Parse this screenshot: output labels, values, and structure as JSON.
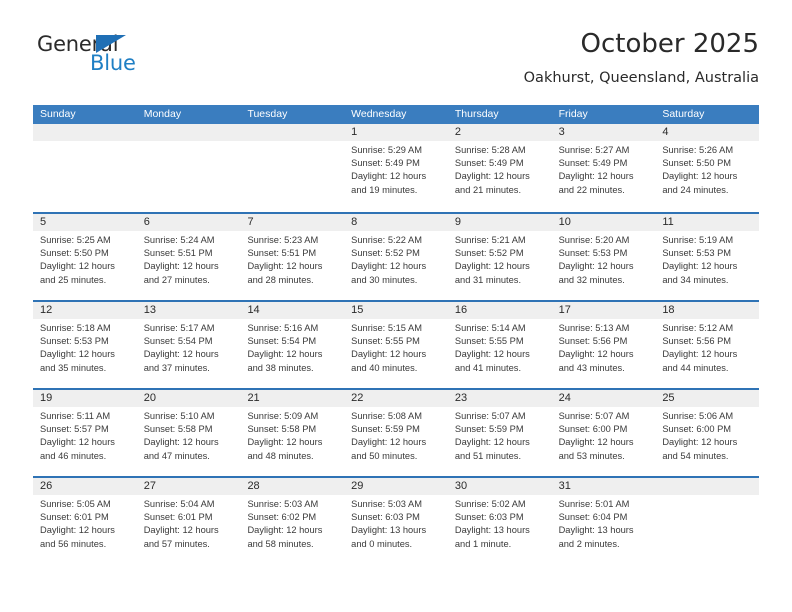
{
  "brand": {
    "name_top": "General",
    "name_bottom": "Blue",
    "triangle_icon": "triangle-icon",
    "colors": {
      "general_text": "#2b2b2b",
      "blue_text": "#1f7fc4",
      "triangle": "#1f6fb5"
    }
  },
  "header": {
    "title": "October 2025",
    "subtitle": "Oakhurst, Queensland, Australia"
  },
  "theme": {
    "header_blue": "#3a7dbf",
    "row_divider_blue": "#2f73b5",
    "day_band_gray": "#efefef"
  },
  "calendar": {
    "weekdays": [
      "Sunday",
      "Monday",
      "Tuesday",
      "Wednesday",
      "Thursday",
      "Friday",
      "Saturday"
    ],
    "weeks": [
      [
        {
          "day": "",
          "lines": []
        },
        {
          "day": "",
          "lines": []
        },
        {
          "day": "",
          "lines": []
        },
        {
          "day": "1",
          "lines": [
            "Sunrise: 5:29 AM",
            "Sunset: 5:49 PM",
            "Daylight: 12 hours",
            "and 19 minutes."
          ]
        },
        {
          "day": "2",
          "lines": [
            "Sunrise: 5:28 AM",
            "Sunset: 5:49 PM",
            "Daylight: 12 hours",
            "and 21 minutes."
          ]
        },
        {
          "day": "3",
          "lines": [
            "Sunrise: 5:27 AM",
            "Sunset: 5:49 PM",
            "Daylight: 12 hours",
            "and 22 minutes."
          ]
        },
        {
          "day": "4",
          "lines": [
            "Sunrise: 5:26 AM",
            "Sunset: 5:50 PM",
            "Daylight: 12 hours",
            "and 24 minutes."
          ]
        }
      ],
      [
        {
          "day": "5",
          "lines": [
            "Sunrise: 5:25 AM",
            "Sunset: 5:50 PM",
            "Daylight: 12 hours",
            "and 25 minutes."
          ]
        },
        {
          "day": "6",
          "lines": [
            "Sunrise: 5:24 AM",
            "Sunset: 5:51 PM",
            "Daylight: 12 hours",
            "and 27 minutes."
          ]
        },
        {
          "day": "7",
          "lines": [
            "Sunrise: 5:23 AM",
            "Sunset: 5:51 PM",
            "Daylight: 12 hours",
            "and 28 minutes."
          ]
        },
        {
          "day": "8",
          "lines": [
            "Sunrise: 5:22 AM",
            "Sunset: 5:52 PM",
            "Daylight: 12 hours",
            "and 30 minutes."
          ]
        },
        {
          "day": "9",
          "lines": [
            "Sunrise: 5:21 AM",
            "Sunset: 5:52 PM",
            "Daylight: 12 hours",
            "and 31 minutes."
          ]
        },
        {
          "day": "10",
          "lines": [
            "Sunrise: 5:20 AM",
            "Sunset: 5:53 PM",
            "Daylight: 12 hours",
            "and 32 minutes."
          ]
        },
        {
          "day": "11",
          "lines": [
            "Sunrise: 5:19 AM",
            "Sunset: 5:53 PM",
            "Daylight: 12 hours",
            "and 34 minutes."
          ]
        }
      ],
      [
        {
          "day": "12",
          "lines": [
            "Sunrise: 5:18 AM",
            "Sunset: 5:53 PM",
            "Daylight: 12 hours",
            "and 35 minutes."
          ]
        },
        {
          "day": "13",
          "lines": [
            "Sunrise: 5:17 AM",
            "Sunset: 5:54 PM",
            "Daylight: 12 hours",
            "and 37 minutes."
          ]
        },
        {
          "day": "14",
          "lines": [
            "Sunrise: 5:16 AM",
            "Sunset: 5:54 PM",
            "Daylight: 12 hours",
            "and 38 minutes."
          ]
        },
        {
          "day": "15",
          "lines": [
            "Sunrise: 5:15 AM",
            "Sunset: 5:55 PM",
            "Daylight: 12 hours",
            "and 40 minutes."
          ]
        },
        {
          "day": "16",
          "lines": [
            "Sunrise: 5:14 AM",
            "Sunset: 5:55 PM",
            "Daylight: 12 hours",
            "and 41 minutes."
          ]
        },
        {
          "day": "17",
          "lines": [
            "Sunrise: 5:13 AM",
            "Sunset: 5:56 PM",
            "Daylight: 12 hours",
            "and 43 minutes."
          ]
        },
        {
          "day": "18",
          "lines": [
            "Sunrise: 5:12 AM",
            "Sunset: 5:56 PM",
            "Daylight: 12 hours",
            "and 44 minutes."
          ]
        }
      ],
      [
        {
          "day": "19",
          "lines": [
            "Sunrise: 5:11 AM",
            "Sunset: 5:57 PM",
            "Daylight: 12 hours",
            "and 46 minutes."
          ]
        },
        {
          "day": "20",
          "lines": [
            "Sunrise: 5:10 AM",
            "Sunset: 5:58 PM",
            "Daylight: 12 hours",
            "and 47 minutes."
          ]
        },
        {
          "day": "21",
          "lines": [
            "Sunrise: 5:09 AM",
            "Sunset: 5:58 PM",
            "Daylight: 12 hours",
            "and 48 minutes."
          ]
        },
        {
          "day": "22",
          "lines": [
            "Sunrise: 5:08 AM",
            "Sunset: 5:59 PM",
            "Daylight: 12 hours",
            "and 50 minutes."
          ]
        },
        {
          "day": "23",
          "lines": [
            "Sunrise: 5:07 AM",
            "Sunset: 5:59 PM",
            "Daylight: 12 hours",
            "and 51 minutes."
          ]
        },
        {
          "day": "24",
          "lines": [
            "Sunrise: 5:07 AM",
            "Sunset: 6:00 PM",
            "Daylight: 12 hours",
            "and 53 minutes."
          ]
        },
        {
          "day": "25",
          "lines": [
            "Sunrise: 5:06 AM",
            "Sunset: 6:00 PM",
            "Daylight: 12 hours",
            "and 54 minutes."
          ]
        }
      ],
      [
        {
          "day": "26",
          "lines": [
            "Sunrise: 5:05 AM",
            "Sunset: 6:01 PM",
            "Daylight: 12 hours",
            "and 56 minutes."
          ]
        },
        {
          "day": "27",
          "lines": [
            "Sunrise: 5:04 AM",
            "Sunset: 6:01 PM",
            "Daylight: 12 hours",
            "and 57 minutes."
          ]
        },
        {
          "day": "28",
          "lines": [
            "Sunrise: 5:03 AM",
            "Sunset: 6:02 PM",
            "Daylight: 12 hours",
            "and 58 minutes."
          ]
        },
        {
          "day": "29",
          "lines": [
            "Sunrise: 5:03 AM",
            "Sunset: 6:03 PM",
            "Daylight: 13 hours",
            "and 0 minutes."
          ]
        },
        {
          "day": "30",
          "lines": [
            "Sunrise: 5:02 AM",
            "Sunset: 6:03 PM",
            "Daylight: 13 hours",
            "and 1 minute."
          ]
        },
        {
          "day": "31",
          "lines": [
            "Sunrise: 5:01 AM",
            "Sunset: 6:04 PM",
            "Daylight: 13 hours",
            "and 2 minutes."
          ]
        },
        {
          "day": "",
          "lines": []
        }
      ]
    ]
  }
}
